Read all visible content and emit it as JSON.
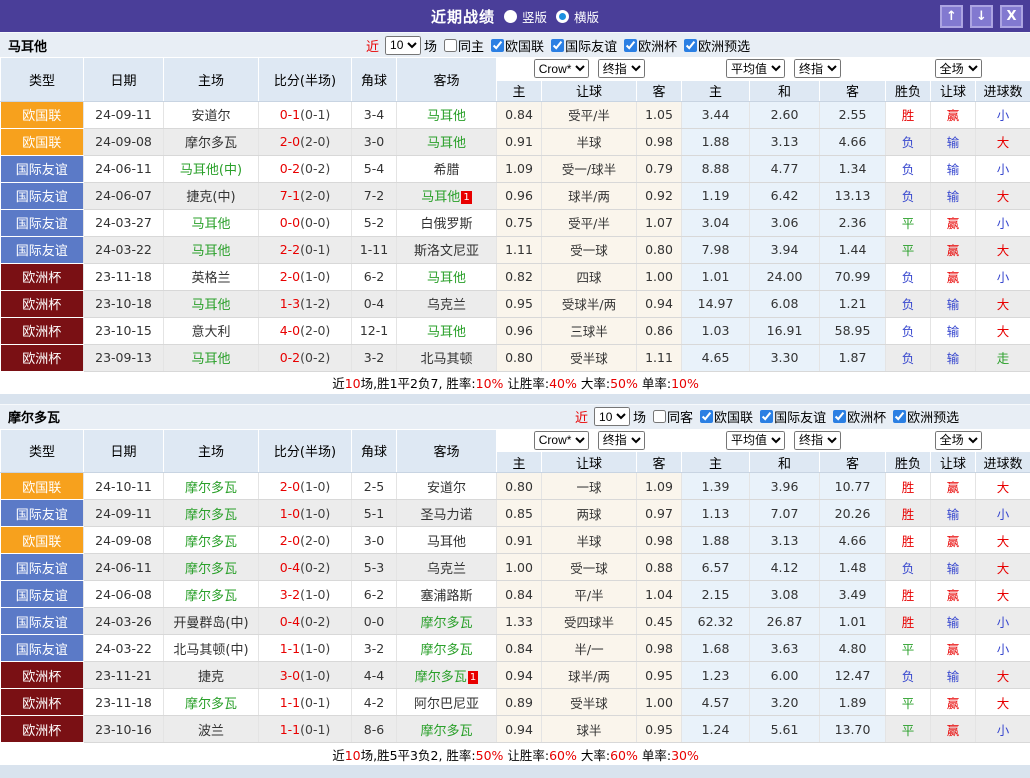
{
  "title_bar": {
    "title": "近期战绩",
    "radio_vertical": "竖版",
    "radio_horizontal": "横版",
    "buttons": {
      "up_icon": "↑",
      "down_icon": "↓",
      "close_icon": "X"
    }
  },
  "filter": {
    "near": "近",
    "count": "10",
    "matches_label": "场",
    "comps": [
      "欧国联",
      "国际友谊",
      "欧洲杯",
      "欧洲预选"
    ]
  },
  "header": {
    "col_type": "类型",
    "col_date": "日期",
    "col_home": "主场",
    "col_score": "比分(半场)",
    "col_corner": "角球",
    "col_away": "客场",
    "sel_crow": "Crow*",
    "sel_final1": "终指",
    "sel_avg": "平均值",
    "sel_final2": "终指",
    "sel_scope": "全场",
    "sub": [
      "主",
      "让球",
      "客",
      "主",
      "和",
      "客",
      "胜负",
      "让球",
      "进球数"
    ]
  },
  "sections": [
    {
      "team": "马耳他",
      "same_label": "同主",
      "rows": [
        {
          "type": "欧国联",
          "tc": "o",
          "date": "24-09-11",
          "home": "安道尔",
          "home_green": false,
          "home_badge": "",
          "ft": "0-1",
          "half": "(0-1)",
          "corners": "3-4",
          "away": "马耳他",
          "away_green": true,
          "away_badge": "",
          "crow_home": "0.84",
          "handicap": "受平/半",
          "crow_away": "1.05",
          "avg_home": "3.44",
          "avg_draw": "2.60",
          "avg_away": "2.55",
          "wdl": "胜",
          "wdl_c": "r",
          "cover": "赢",
          "cover_c": "r",
          "ou": "小",
          "ou_c": "b"
        },
        {
          "type": "欧国联",
          "tc": "o",
          "date": "24-09-08",
          "home": "摩尔多瓦",
          "home_green": false,
          "home_badge": "",
          "ft": "2-0",
          "half": "(2-0)",
          "corners": "3-0",
          "away": "马耳他",
          "away_green": true,
          "away_badge": "",
          "crow_home": "0.91",
          "handicap": "半球",
          "crow_away": "0.98",
          "avg_home": "1.88",
          "avg_draw": "3.13",
          "avg_away": "4.66",
          "wdl": "负",
          "wdl_c": "b",
          "cover": "输",
          "cover_c": "b",
          "ou": "大",
          "ou_c": "r"
        },
        {
          "type": "国际友谊",
          "tc": "b",
          "date": "24-06-11",
          "home": "马耳他(中)",
          "home_green": true,
          "home_badge": "",
          "ft": "0-2",
          "half": "(0-2)",
          "corners": "5-4",
          "away": "希腊",
          "away_green": false,
          "away_badge": "",
          "crow_home": "1.09",
          "handicap": "受一/球半",
          "crow_away": "0.79",
          "avg_home": "8.88",
          "avg_draw": "4.77",
          "avg_away": "1.34",
          "wdl": "负",
          "wdl_c": "b",
          "cover": "输",
          "cover_c": "b",
          "ou": "小",
          "ou_c": "b"
        },
        {
          "type": "国际友谊",
          "tc": "b",
          "date": "24-06-07",
          "home": "捷克(中)",
          "home_green": false,
          "home_badge": "",
          "ft": "7-1",
          "half": "(2-0)",
          "corners": "7-2",
          "away": "马耳他",
          "away_green": true,
          "away_badge": "1",
          "crow_home": "0.96",
          "handicap": "球半/两",
          "crow_away": "0.92",
          "avg_home": "1.19",
          "avg_draw": "6.42",
          "avg_away": "13.13",
          "wdl": "负",
          "wdl_c": "b",
          "cover": "输",
          "cover_c": "b",
          "ou": "大",
          "ou_c": "r"
        },
        {
          "type": "国际友谊",
          "tc": "b",
          "date": "24-03-27",
          "home": "马耳他",
          "home_green": true,
          "home_badge": "",
          "ft": "0-0",
          "half": "(0-0)",
          "corners": "5-2",
          "away": "白俄罗斯",
          "away_green": false,
          "away_badge": "",
          "crow_home": "0.75",
          "handicap": "受平/半",
          "crow_away": "1.07",
          "avg_home": "3.04",
          "avg_draw": "3.06",
          "avg_away": "2.36",
          "wdl": "平",
          "wdl_c": "g",
          "cover": "赢",
          "cover_c": "r",
          "ou": "小",
          "ou_c": "b"
        },
        {
          "type": "国际友谊",
          "tc": "b",
          "date": "24-03-22",
          "home": "马耳他",
          "home_green": true,
          "home_badge": "",
          "ft": "2-2",
          "half": "(0-1)",
          "corners": "1-11",
          "away": "斯洛文尼亚",
          "away_green": false,
          "away_badge": "",
          "crow_home": "1.11",
          "handicap": "受一球",
          "crow_away": "0.80",
          "avg_home": "7.98",
          "avg_draw": "3.94",
          "avg_away": "1.44",
          "wdl": "平",
          "wdl_c": "g",
          "cover": "赢",
          "cover_c": "r",
          "ou": "大",
          "ou_c": "r"
        },
        {
          "type": "欧洲杯",
          "tc": "m",
          "date": "23-11-18",
          "home": "英格兰",
          "home_green": false,
          "home_badge": "",
          "ft": "2-0",
          "half": "(1-0)",
          "corners": "6-2",
          "away": "马耳他",
          "away_green": true,
          "away_badge": "",
          "crow_home": "0.82",
          "handicap": "四球",
          "crow_away": "1.00",
          "avg_home": "1.01",
          "avg_draw": "24.00",
          "avg_away": "70.99",
          "wdl": "负",
          "wdl_c": "b",
          "cover": "赢",
          "cover_c": "r",
          "ou": "小",
          "ou_c": "b"
        },
        {
          "type": "欧洲杯",
          "tc": "m",
          "date": "23-10-18",
          "home": "马耳他",
          "home_green": true,
          "home_badge": "",
          "ft": "1-3",
          "half": "(1-2)",
          "corners": "0-4",
          "away": "乌克兰",
          "away_green": false,
          "away_badge": "",
          "crow_home": "0.95",
          "handicap": "受球半/两",
          "crow_away": "0.94",
          "avg_home": "14.97",
          "avg_draw": "6.08",
          "avg_away": "1.21",
          "wdl": "负",
          "wdl_c": "b",
          "cover": "输",
          "cover_c": "b",
          "ou": "大",
          "ou_c": "r"
        },
        {
          "type": "欧洲杯",
          "tc": "m",
          "date": "23-10-15",
          "home": "意大利",
          "home_green": false,
          "home_badge": "",
          "ft": "4-0",
          "half": "(2-0)",
          "corners": "12-1",
          "away": "马耳他",
          "away_green": true,
          "away_badge": "",
          "crow_home": "0.96",
          "handicap": "三球半",
          "crow_away": "0.86",
          "avg_home": "1.03",
          "avg_draw": "16.91",
          "avg_away": "58.95",
          "wdl": "负",
          "wdl_c": "b",
          "cover": "输",
          "cover_c": "b",
          "ou": "大",
          "ou_c": "r"
        },
        {
          "type": "欧洲杯",
          "tc": "m",
          "date": "23-09-13",
          "home": "马耳他",
          "home_green": true,
          "home_badge": "",
          "ft": "0-2",
          "half": "(0-2)",
          "corners": "3-2",
          "away": "北马其顿",
          "away_green": false,
          "away_badge": "",
          "crow_home": "0.80",
          "handicap": "受半球",
          "crow_away": "1.11",
          "avg_home": "4.65",
          "avg_draw": "3.30",
          "avg_away": "1.87",
          "wdl": "负",
          "wdl_c": "b",
          "cover": "输",
          "cover_c": "b",
          "ou": "走",
          "ou_c": "g"
        }
      ],
      "summary": [
        {
          "t": "近",
          "c": "k"
        },
        {
          "t": "10",
          "c": "r"
        },
        {
          "t": "场,胜1平2负7, 胜率:",
          "c": "k"
        },
        {
          "t": "10%",
          "c": "r"
        },
        {
          "t": " 让胜率:",
          "c": "k"
        },
        {
          "t": "40%",
          "c": "r"
        },
        {
          "t": " 大率:",
          "c": "k"
        },
        {
          "t": "50%",
          "c": "r"
        },
        {
          "t": " 单率:",
          "c": "k"
        },
        {
          "t": "10%",
          "c": "r"
        }
      ]
    },
    {
      "team": "摩尔多瓦",
      "same_label": "同客",
      "rows": [
        {
          "type": "欧国联",
          "tc": "o",
          "date": "24-10-11",
          "home": "摩尔多瓦",
          "home_green": true,
          "home_badge": "",
          "ft": "2-0",
          "half": "(1-0)",
          "corners": "2-5",
          "away": "安道尔",
          "away_green": false,
          "away_badge": "",
          "crow_home": "0.80",
          "handicap": "一球",
          "crow_away": "1.09",
          "avg_home": "1.39",
          "avg_draw": "3.96",
          "avg_away": "10.77",
          "wdl": "胜",
          "wdl_c": "r",
          "cover": "赢",
          "cover_c": "r",
          "ou": "大",
          "ou_c": "r"
        },
        {
          "type": "国际友谊",
          "tc": "b",
          "date": "24-09-11",
          "home": "摩尔多瓦",
          "home_green": true,
          "home_badge": "",
          "ft": "1-0",
          "half": "(1-0)",
          "corners": "5-1",
          "away": "圣马力诺",
          "away_green": false,
          "away_badge": "",
          "crow_home": "0.85",
          "handicap": "两球",
          "crow_away": "0.97",
          "avg_home": "1.13",
          "avg_draw": "7.07",
          "avg_away": "20.26",
          "wdl": "胜",
          "wdl_c": "r",
          "cover": "输",
          "cover_c": "b",
          "ou": "小",
          "ou_c": "b"
        },
        {
          "type": "欧国联",
          "tc": "o",
          "date": "24-09-08",
          "home": "摩尔多瓦",
          "home_green": true,
          "home_badge": "",
          "ft": "2-0",
          "half": "(2-0)",
          "corners": "3-0",
          "away": "马耳他",
          "away_green": false,
          "away_badge": "",
          "crow_home": "0.91",
          "handicap": "半球",
          "crow_away": "0.98",
          "avg_home": "1.88",
          "avg_draw": "3.13",
          "avg_away": "4.66",
          "wdl": "胜",
          "wdl_c": "r",
          "cover": "赢",
          "cover_c": "r",
          "ou": "大",
          "ou_c": "r"
        },
        {
          "type": "国际友谊",
          "tc": "b",
          "date": "24-06-11",
          "home": "摩尔多瓦",
          "home_green": true,
          "home_badge": "",
          "ft": "0-4",
          "half": "(0-2)",
          "corners": "5-3",
          "away": "乌克兰",
          "away_green": false,
          "away_badge": "",
          "crow_home": "1.00",
          "handicap": "受一球",
          "crow_away": "0.88",
          "avg_home": "6.57",
          "avg_draw": "4.12",
          "avg_away": "1.48",
          "wdl": "负",
          "wdl_c": "b",
          "cover": "输",
          "cover_c": "b",
          "ou": "大",
          "ou_c": "r"
        },
        {
          "type": "国际友谊",
          "tc": "b",
          "date": "24-06-08",
          "home": "摩尔多瓦",
          "home_green": true,
          "home_badge": "",
          "ft": "3-2",
          "half": "(1-0)",
          "corners": "6-2",
          "away": "塞浦路斯",
          "away_green": false,
          "away_badge": "",
          "crow_home": "0.84",
          "handicap": "平/半",
          "crow_away": "1.04",
          "avg_home": "2.15",
          "avg_draw": "3.08",
          "avg_away": "3.49",
          "wdl": "胜",
          "wdl_c": "r",
          "cover": "赢",
          "cover_c": "r",
          "ou": "大",
          "ou_c": "r"
        },
        {
          "type": "国际友谊",
          "tc": "b",
          "date": "24-03-26",
          "home": "开曼群岛(中)",
          "home_green": false,
          "home_badge": "",
          "ft": "0-4",
          "half": "(0-2)",
          "corners": "0-0",
          "away": "摩尔多瓦",
          "away_green": true,
          "away_badge": "",
          "crow_home": "1.33",
          "handicap": "受四球半",
          "crow_away": "0.45",
          "avg_home": "62.32",
          "avg_draw": "26.87",
          "avg_away": "1.01",
          "wdl": "胜",
          "wdl_c": "r",
          "cover": "输",
          "cover_c": "b",
          "ou": "小",
          "ou_c": "b"
        },
        {
          "type": "国际友谊",
          "tc": "b",
          "date": "24-03-22",
          "home": "北马其顿(中)",
          "home_green": false,
          "home_badge": "",
          "ft": "1-1",
          "half": "(1-0)",
          "corners": "3-2",
          "away": "摩尔多瓦",
          "away_green": true,
          "away_badge": "",
          "crow_home": "0.84",
          "handicap": "半/一",
          "crow_away": "0.98",
          "avg_home": "1.68",
          "avg_draw": "3.63",
          "avg_away": "4.80",
          "wdl": "平",
          "wdl_c": "g",
          "cover": "赢",
          "cover_c": "r",
          "ou": "小",
          "ou_c": "b"
        },
        {
          "type": "欧洲杯",
          "tc": "m",
          "date": "23-11-21",
          "home": "捷克",
          "home_green": false,
          "home_badge": "",
          "ft": "3-0",
          "half": "(1-0)",
          "corners": "4-4",
          "away": "摩尔多瓦",
          "away_green": true,
          "away_badge": "1",
          "crow_home": "0.94",
          "handicap": "球半/两",
          "crow_away": "0.95",
          "avg_home": "1.23",
          "avg_draw": "6.00",
          "avg_away": "12.47",
          "wdl": "负",
          "wdl_c": "b",
          "cover": "输",
          "cover_c": "b",
          "ou": "大",
          "ou_c": "r"
        },
        {
          "type": "欧洲杯",
          "tc": "m",
          "date": "23-11-18",
          "home": "摩尔多瓦",
          "home_green": true,
          "home_badge": "",
          "ft": "1-1",
          "half": "(0-1)",
          "corners": "4-2",
          "away": "阿尔巴尼亚",
          "away_green": false,
          "away_badge": "",
          "crow_home": "0.89",
          "handicap": "受半球",
          "crow_away": "1.00",
          "avg_home": "4.57",
          "avg_draw": "3.20",
          "avg_away": "1.89",
          "wdl": "平",
          "wdl_c": "g",
          "cover": "赢",
          "cover_c": "r",
          "ou": "大",
          "ou_c": "r"
        },
        {
          "type": "欧洲杯",
          "tc": "m",
          "date": "23-10-16",
          "home": "波兰",
          "home_green": false,
          "home_badge": "",
          "ft": "1-1",
          "half": "(0-1)",
          "corners": "8-6",
          "away": "摩尔多瓦",
          "away_green": true,
          "away_badge": "",
          "crow_home": "0.94",
          "handicap": "球半",
          "crow_away": "0.95",
          "avg_home": "1.24",
          "avg_draw": "5.61",
          "avg_away": "13.70",
          "wdl": "平",
          "wdl_c": "g",
          "cover": "赢",
          "cover_c": "r",
          "ou": "小",
          "ou_c": "b"
        }
      ],
      "summary": [
        {
          "t": "近",
          "c": "k"
        },
        {
          "t": "10",
          "c": "r"
        },
        {
          "t": "场,胜5平3负2, 胜率:",
          "c": "k"
        },
        {
          "t": "50%",
          "c": "r"
        },
        {
          "t": " 让胜率:",
          "c": "k"
        },
        {
          "t": "60%",
          "c": "r"
        },
        {
          "t": " 大率:",
          "c": "k"
        },
        {
          "t": "60%",
          "c": "r"
        },
        {
          "t": " 单率:",
          "c": "k"
        },
        {
          "t": "30%",
          "c": "r"
        }
      ]
    }
  ]
}
